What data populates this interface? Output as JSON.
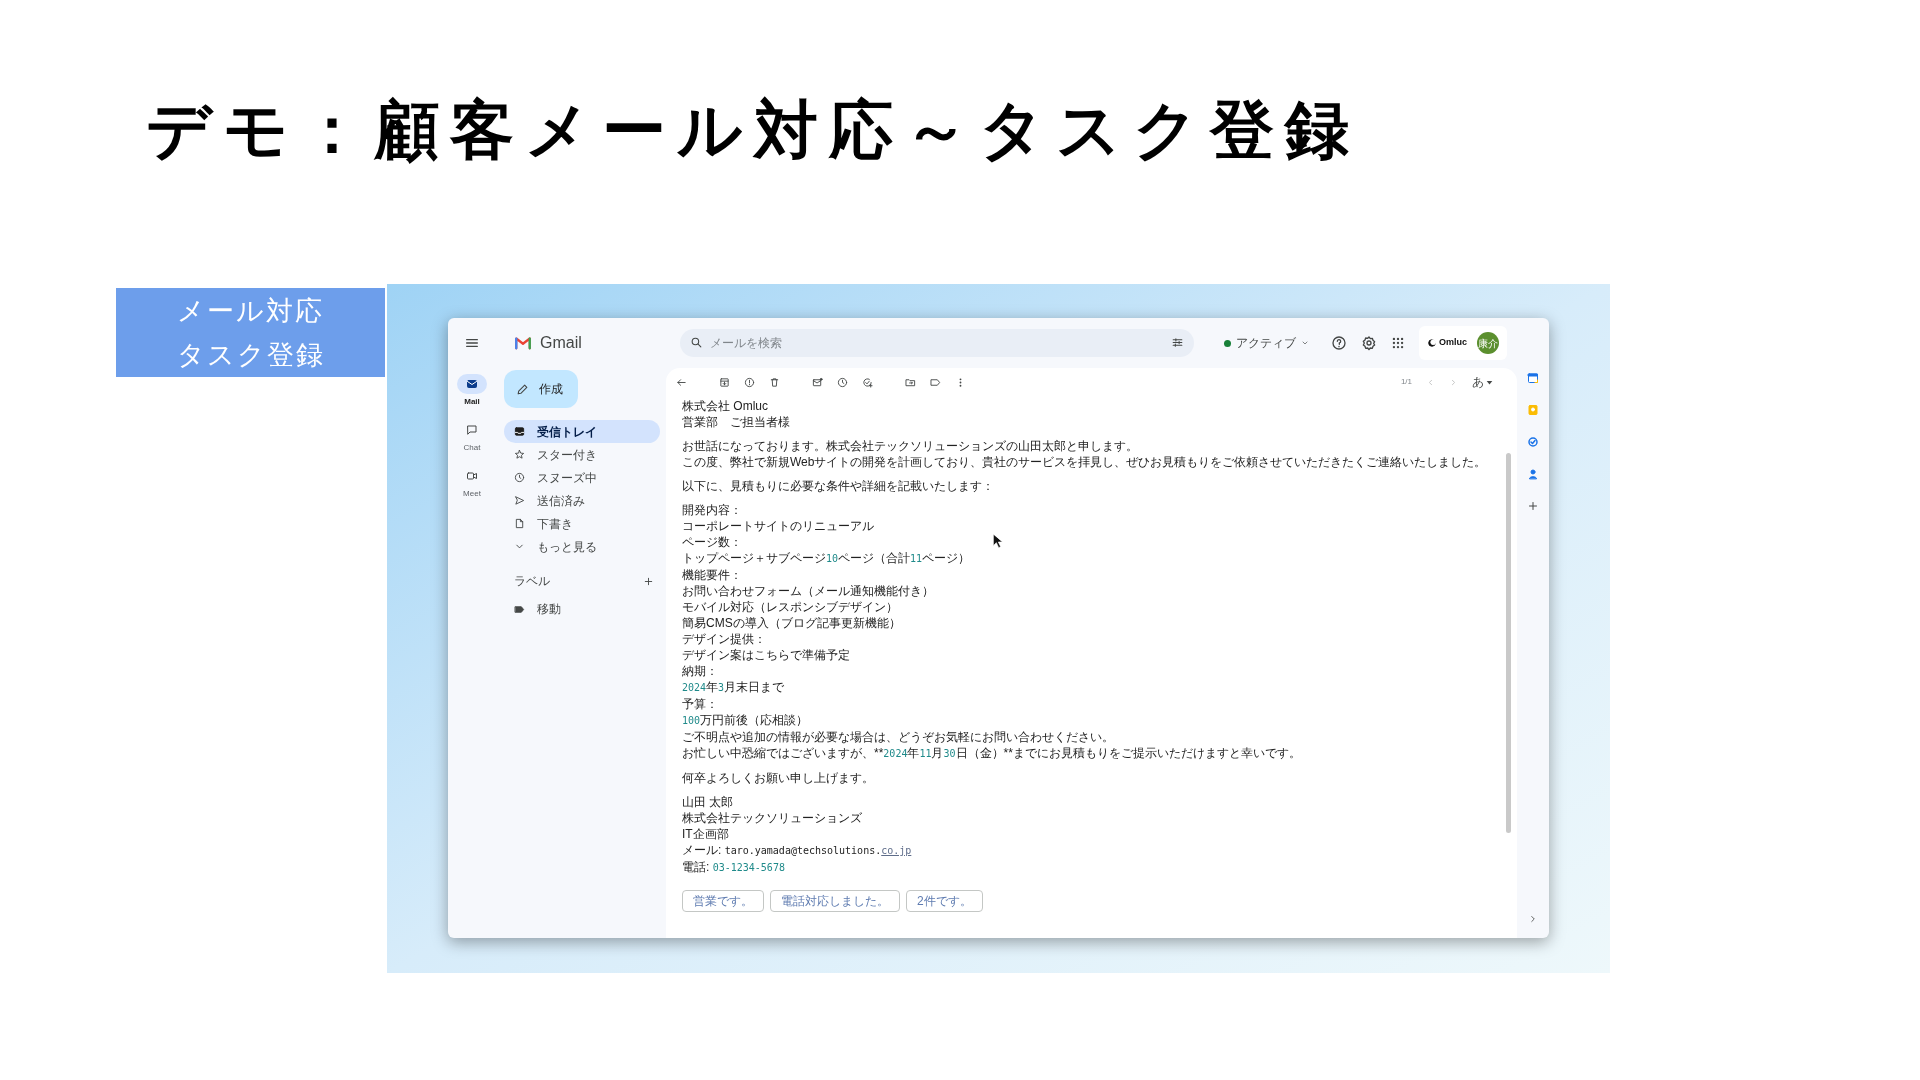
{
  "slide": {
    "title": "デモ：顧客メール対応～タスク登録",
    "side_label": [
      "メール対応",
      "タスク登録"
    ]
  },
  "gmail": {
    "app_name": "Gmail",
    "search": {
      "placeholder": "メールを検索"
    },
    "status": "アクティブ",
    "org_logo": "Omluc",
    "avatar": "康介",
    "rail": [
      {
        "label": "Mail",
        "kind": "mail",
        "selected": true
      },
      {
        "label": "Chat",
        "kind": "chat",
        "selected": false
      },
      {
        "label": "Meet",
        "kind": "meet",
        "selected": false
      }
    ],
    "compose": "作成",
    "nav": [
      {
        "label": "受信トレイ",
        "kind": "inbox",
        "selected": true
      },
      {
        "label": "スター付き",
        "kind": "star",
        "selected": false
      },
      {
        "label": "スヌーズ中",
        "kind": "snooze",
        "selected": false
      },
      {
        "label": "送信済み",
        "kind": "sent",
        "selected": false
      },
      {
        "label": "下書き",
        "kind": "draft",
        "selected": false
      },
      {
        "label": "もっと見る",
        "kind": "more",
        "selected": false
      }
    ],
    "labels_heading": "ラベル",
    "labels": [
      {
        "name": "移動"
      }
    ],
    "pager": "1/1",
    "input_tool": "あ",
    "body": [
      [
        {
          "text": "株式会社 Omluc"
        },
        {
          "text": "営業部　ご担当者様"
        }
      ],
      [
        {
          "text": "お世話になっております。株式会社テックソリューションズの山田太郎と申します。"
        },
        {
          "text": "この度、弊社で新規Webサイトの開発を計画しており、貴社のサービスを拝見し、ぜひお見積もりをご依頼させていただきたくご連絡いたしました。"
        }
      ],
      [
        {
          "text": "以下に、見積もりに必要な条件や詳細を記載いたします："
        }
      ],
      [
        {
          "text": "開発内容："
        },
        {
          "text": "コーポレートサイトのリニューアル"
        },
        {
          "text": "ページ数："
        },
        {
          "parts": [
            {
              "text": "トップページ＋サブページ",
              "kind": "plain"
            },
            {
              "text": "10",
              "kind": "number"
            },
            {
              "text": "ページ（合計",
              "kind": "plain"
            },
            {
              "text": "11",
              "kind": "number"
            },
            {
              "text": "ページ）",
              "kind": "plain"
            }
          ]
        },
        {
          "text": "機能要件："
        },
        {
          "text": "お問い合わせフォーム（メール通知機能付き）"
        },
        {
          "text": "モバイル対応（レスポンシブデザイン）"
        },
        {
          "text": "簡易CMSの導入（ブログ記事更新機能）"
        },
        {
          "text": "デザイン提供："
        },
        {
          "text": "デザイン案はこちらで準備予定"
        },
        {
          "text": "納期："
        },
        {
          "parts": [
            {
              "text": "2024",
              "kind": "number"
            },
            {
              "text": "年",
              "kind": "plain"
            },
            {
              "text": "3",
              "kind": "number"
            },
            {
              "text": "月末日まで",
              "kind": "plain"
            }
          ]
        },
        {
          "text": "予算："
        },
        {
          "parts": [
            {
              "text": "100",
              "kind": "number"
            },
            {
              "text": "万円前後（応相談）",
              "kind": "plain"
            }
          ]
        },
        {
          "text": "ご不明点や追加の情報が必要な場合は、どうぞお気軽にお問い合わせください。"
        },
        {
          "parts": [
            {
              "text": "お忙しい中恐縮ではございますが、**",
              "kind": "plain"
            },
            {
              "text": "2024",
              "kind": "number"
            },
            {
              "text": "年",
              "kind": "plain"
            },
            {
              "text": "11",
              "kind": "number"
            },
            {
              "text": "月",
              "kind": "plain"
            },
            {
              "text": "30",
              "kind": "number"
            },
            {
              "text": "日（金）**までにお見積もりをご提示いただけますと幸いです。",
              "kind": "plain"
            }
          ]
        }
      ],
      [
        {
          "text": "何卒よろしくお願い申し上げます。"
        }
      ],
      [
        {
          "text": "山田 太郎"
        },
        {
          "text": "株式会社テックソリューションズ"
        },
        {
          "text": "IT企画部"
        },
        {
          "parts": [
            {
              "text": "メール: ",
              "kind": "plain"
            },
            {
              "text": "taro.yamada@techsolutions.",
              "kind": "mono"
            },
            {
              "text": "co.jp",
              "kind": "link"
            }
          ]
        },
        {
          "parts": [
            {
              "text": "電話: ",
              "kind": "plain"
            },
            {
              "text": "03-1234-5678",
              "kind": "phone"
            }
          ]
        }
      ]
    ],
    "smart_replies": [
      "営業です。",
      "電話対応しました。",
      "2件です。"
    ],
    "side_apps": [
      {
        "kind": "calendar"
      },
      {
        "kind": "keep"
      },
      {
        "kind": "tasks"
      },
      {
        "kind": "contacts"
      },
      {
        "kind": "add"
      }
    ]
  }
}
